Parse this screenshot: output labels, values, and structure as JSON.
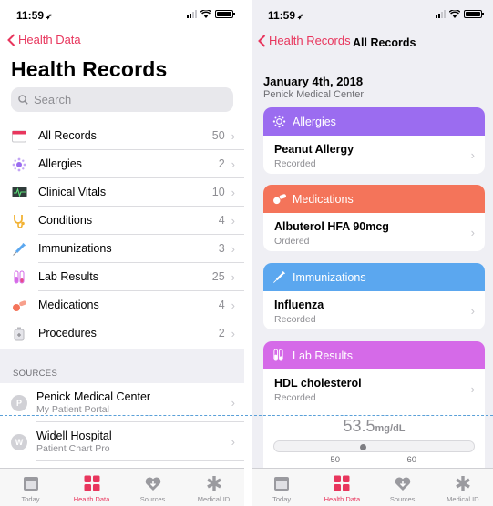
{
  "status_bar": {
    "time": "11:59",
    "location_glyph": "➶"
  },
  "left": {
    "back_label": "Health Data",
    "title": "Health Records",
    "search_placeholder": "Search",
    "categories": [
      {
        "label": "All Records",
        "count": "50",
        "icon": "calendar-icon"
      },
      {
        "label": "Allergies",
        "count": "2",
        "icon": "allergen-icon"
      },
      {
        "label": "Clinical Vitals",
        "count": "10",
        "icon": "vitals-monitor-icon"
      },
      {
        "label": "Conditions",
        "count": "4",
        "icon": "stethoscope-icon"
      },
      {
        "label": "Immunizations",
        "count": "3",
        "icon": "syringe-icon"
      },
      {
        "label": "Lab Results",
        "count": "25",
        "icon": "test-tube-icon"
      },
      {
        "label": "Medications",
        "count": "4",
        "icon": "pills-icon"
      },
      {
        "label": "Procedures",
        "count": "2",
        "icon": "procedure-icon"
      }
    ],
    "sources_header": "SOURCES",
    "sources": [
      {
        "initial": "P",
        "name": "Penick Medical Center",
        "subtitle": "My Patient Portal"
      },
      {
        "initial": "W",
        "name": "Widell Hospital",
        "subtitle": "Patient Chart Pro"
      }
    ]
  },
  "tabs": [
    {
      "label": "Today",
      "icon": "today-icon",
      "active": false
    },
    {
      "label": "Health Data",
      "icon": "health-data-grid-icon",
      "active": true
    },
    {
      "label": "Sources",
      "icon": "sources-heart-icon",
      "active": false
    },
    {
      "label": "Medical ID",
      "icon": "medical-id-asterisk-icon",
      "active": false
    }
  ],
  "right": {
    "back_label": "Health Records",
    "title": "All Records",
    "date": "January 4th, 2018",
    "source": "Penick Medical Center",
    "cards": [
      {
        "header": "Allergies",
        "color": "#9b6cf0",
        "icon": "allergen-icon",
        "title": "Peanut Allergy",
        "status": "Recorded"
      },
      {
        "header": "Medications",
        "color": "#f4745a",
        "icon": "pills-icon",
        "title": "Albuterol HFA 90mcg",
        "status": "Ordered"
      },
      {
        "header": "Immunizations",
        "color": "#5ba7ef",
        "icon": "syringe-icon",
        "title": "Influenza",
        "status": "Recorded"
      },
      {
        "header": "Lab Results",
        "color": "#d56ae8",
        "icon": "test-tube-icon",
        "title": "HDL cholesterol",
        "status": "Recorded"
      }
    ],
    "lab_value": {
      "value": "53.5",
      "unit": "mg/dL",
      "range_low": "50",
      "range_high": "60",
      "value_number": 53.5,
      "low_number": 50,
      "high_number": 60
    }
  },
  "colors": {
    "accent": "#e8365d"
  }
}
